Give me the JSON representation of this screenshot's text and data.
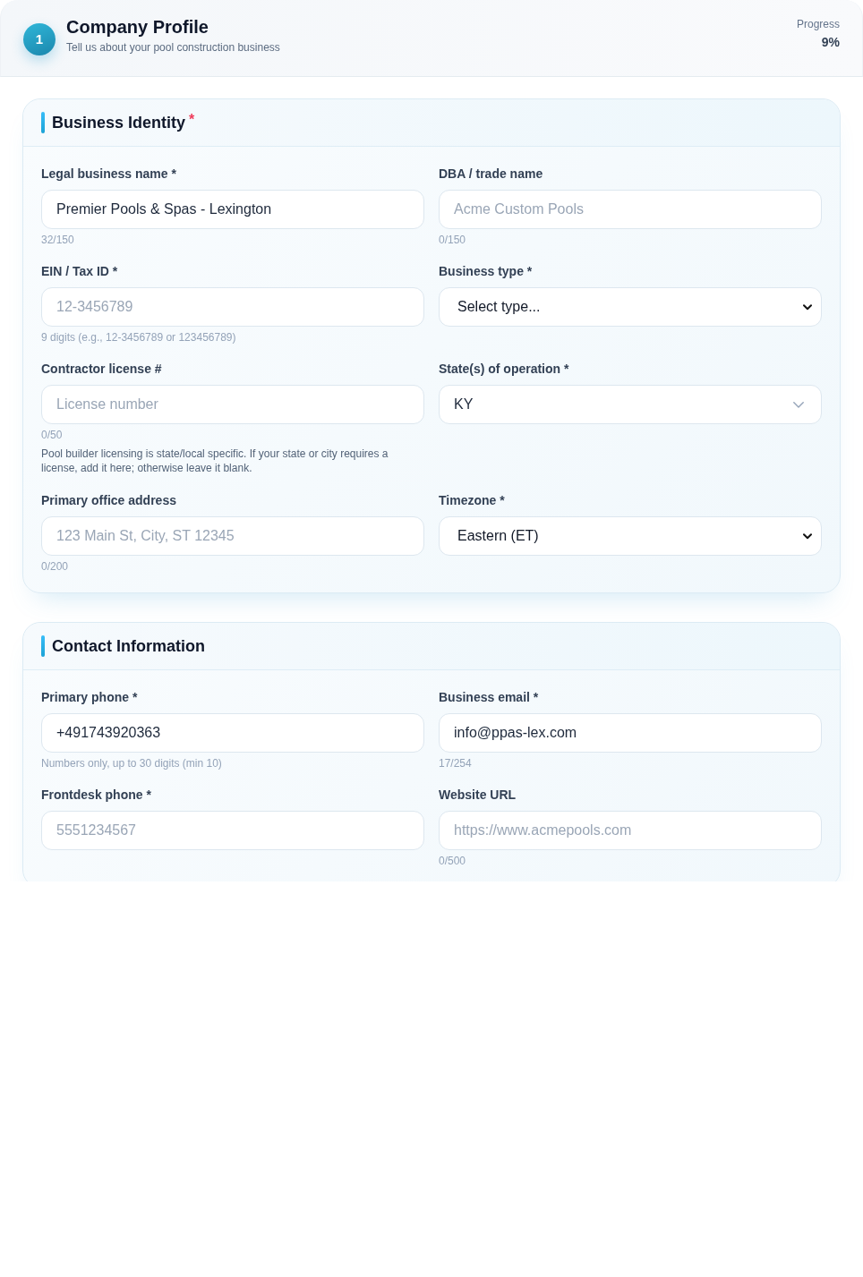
{
  "header": {
    "step": "1",
    "title": "Company Profile",
    "subtitle": "Tell us about your pool construction business",
    "progress": {
      "label": "Progress",
      "value": "9%"
    }
  },
  "sections": [
    {
      "title": "Business Identity",
      "required_mark": "*",
      "fields": [
        {
          "label": "Legal business name *",
          "kind": "text",
          "value": "Premier Pools & Spas - Lexington",
          "helpers": [
            {
              "kind": "counter",
              "text": "32/150"
            }
          ]
        },
        {
          "label": "DBA / trade name",
          "kind": "text",
          "placeholder": "Acme Custom Pools",
          "helpers": [
            {
              "kind": "counter",
              "text": "0/150"
            }
          ]
        },
        {
          "label": "EIN / Tax ID *",
          "kind": "text",
          "placeholder": "12-3456789",
          "helpers": [
            {
              "kind": "hint",
              "text": "9 digits (e.g., 12-3456789 or 123456789)"
            }
          ]
        },
        {
          "label": "Business type *",
          "kind": "select",
          "value": "Select type..."
        },
        {
          "label": "Contractor license #",
          "kind": "text",
          "placeholder": "License number",
          "helpers": [
            {
              "kind": "counter",
              "text": "0/50"
            },
            {
              "kind": "note",
              "text": "Pool builder licensing is state/local specific. If your state or city requires a license, add it here; otherwise leave it blank."
            }
          ]
        },
        {
          "label": "State(s) of operation *",
          "kind": "dropdown",
          "value": "KY"
        },
        {
          "label": "Primary office address",
          "kind": "text",
          "placeholder": "123 Main St, City, ST 12345",
          "helpers": [
            {
              "kind": "counter",
              "text": "0/200"
            }
          ]
        },
        {
          "label": "Timezone *",
          "kind": "select",
          "value": "Eastern (ET)"
        }
      ]
    },
    {
      "title": "Contact Information",
      "fields": [
        {
          "label": "Primary phone *",
          "kind": "text",
          "value": "+491743920363",
          "helpers": [
            {
              "kind": "hint",
              "text": "Numbers only, up to 30 digits (min 10)"
            }
          ]
        },
        {
          "label": "Business email *",
          "kind": "text",
          "value": "info@ppas-lex.com",
          "helpers": [
            {
              "kind": "counter",
              "text": "17/254"
            }
          ]
        },
        {
          "label": "Frontdesk phone *",
          "kind": "text",
          "placeholder": "5551234567"
        },
        {
          "label": "Website URL",
          "kind": "text",
          "placeholder": "https://www.acmepools.com",
          "helpers": [
            {
              "kind": "counter",
              "text": "0/500"
            }
          ]
        }
      ]
    }
  ]
}
